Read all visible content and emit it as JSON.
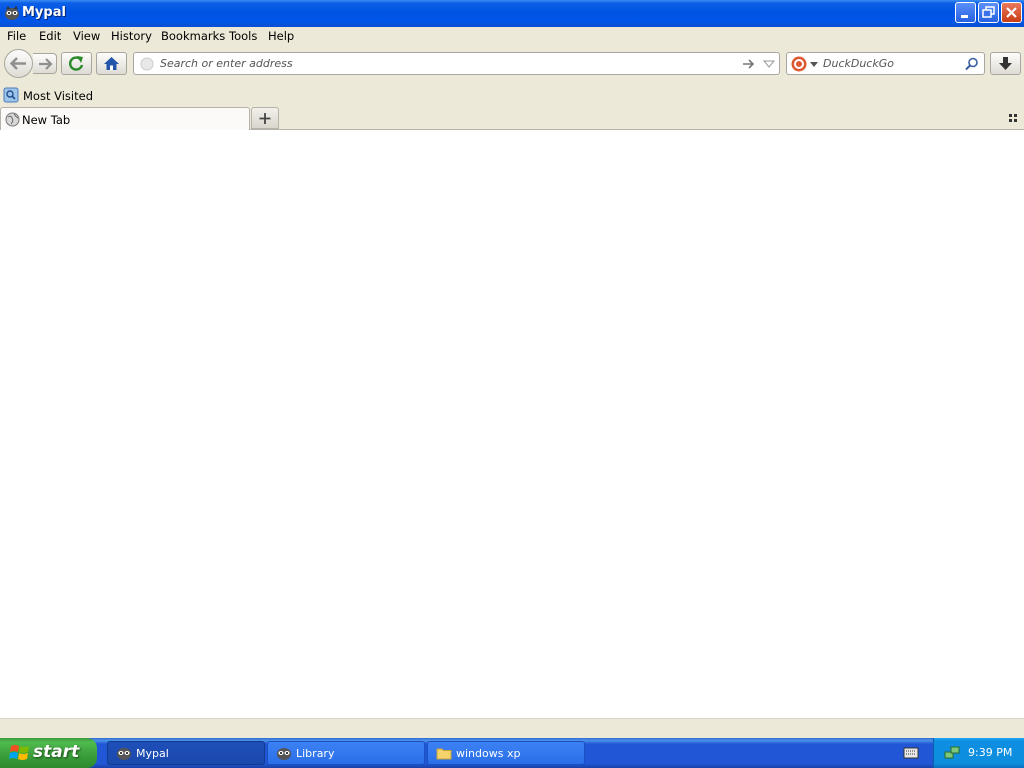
{
  "window": {
    "title": "Mypal",
    "minimize_icon": "minimize-icon",
    "restore_icon": "restore-icon",
    "close_icon": "close-icon"
  },
  "menubar": {
    "items": [
      "File",
      "Edit",
      "View",
      "History",
      "Bookmarks",
      "Tools",
      "Help"
    ]
  },
  "navbar": {
    "url_placeholder": "Search or enter address",
    "search_placeholder": "DuckDuckGo"
  },
  "bookmarks": {
    "items": [
      {
        "label": "Most Visited",
        "icon": "bookmark-folder-icon"
      }
    ]
  },
  "tabs": {
    "items": [
      {
        "label": "New Tab",
        "icon": "globe-icon"
      }
    ]
  },
  "taskbar": {
    "start_label": "start",
    "tasks": [
      {
        "label": "Mypal",
        "icon": "mypal-icon",
        "active": true
      },
      {
        "label": "Library",
        "icon": "mypal-icon",
        "active": false
      },
      {
        "label": "windows xp",
        "icon": "folder-icon",
        "active": false
      }
    ],
    "clock": "9:39 PM"
  },
  "colors": {
    "titlebar": "#0054e3",
    "taskbar": "#2157d7",
    "start_button": "#3c9a3c",
    "tray": "#0f8fe2",
    "chrome": "#ece9d8"
  }
}
